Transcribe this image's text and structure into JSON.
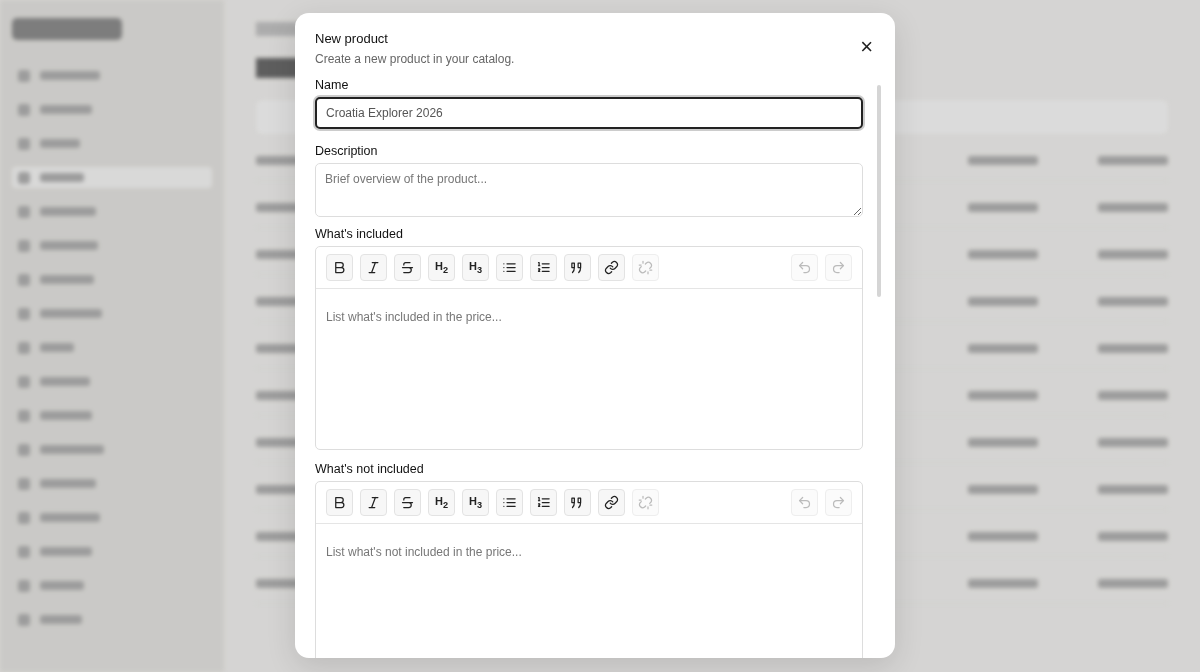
{
  "dialog": {
    "title": "New product",
    "subtitle": "Create a new product in your catalog.",
    "close_label": "×"
  },
  "fields": [
    {
      "kind": "input",
      "label": "Name",
      "value": "Croatia Explorer 2026",
      "focused": true
    },
    {
      "kind": "textarea",
      "label": "Description",
      "placeholder": "Brief overview of the product..."
    }
  ],
  "editors": [
    {
      "label": "What's included",
      "placeholder": "List what's included in the price...",
      "toolbar": [
        {
          "kind": "bold",
          "disabled": false
        },
        {
          "kind": "italic",
          "disabled": false
        },
        {
          "kind": "strike",
          "disabled": false
        },
        {
          "kind": "heading",
          "label": "H$_{2}$",
          "disabled": false
        },
        {
          "kind": "heading",
          "label": "H$_{3}$",
          "disabled": false
        },
        {
          "kind": "bullets",
          "disabled": false
        },
        {
          "kind": "numbers",
          "disabled": false
        },
        {
          "kind": "quote",
          "disabled": false
        },
        {
          "kind": "link",
          "disabled": false
        },
        {
          "kind": "unlink",
          "disabled": true
        },
        {
          "kind": "undo",
          "disabled": true
        },
        {
          "kind": "redo",
          "disabled": true
        }
      ]
    },
    {
      "label": "What's not included",
      "placeholder": "List what's not included in the price...",
      "toolbar": [
        {
          "kind": "bold",
          "disabled": false
        },
        {
          "kind": "italic",
          "disabled": false
        },
        {
          "kind": "strike",
          "disabled": false
        },
        {
          "kind": "heading",
          "label": "H$_{2}$",
          "disabled": false
        },
        {
          "kind": "heading",
          "label": "H$_{3}$",
          "disabled": false
        },
        {
          "kind": "bullets",
          "disabled": false
        },
        {
          "kind": "numbers",
          "disabled": false
        },
        {
          "kind": "quote",
          "disabled": false
        },
        {
          "kind": "link",
          "disabled": false
        },
        {
          "kind": "unlink",
          "disabled": true
        },
        {
          "kind": "undo",
          "disabled": true
        },
        {
          "kind": "redo",
          "disabled": true
        }
      ]
    }
  ]
}
